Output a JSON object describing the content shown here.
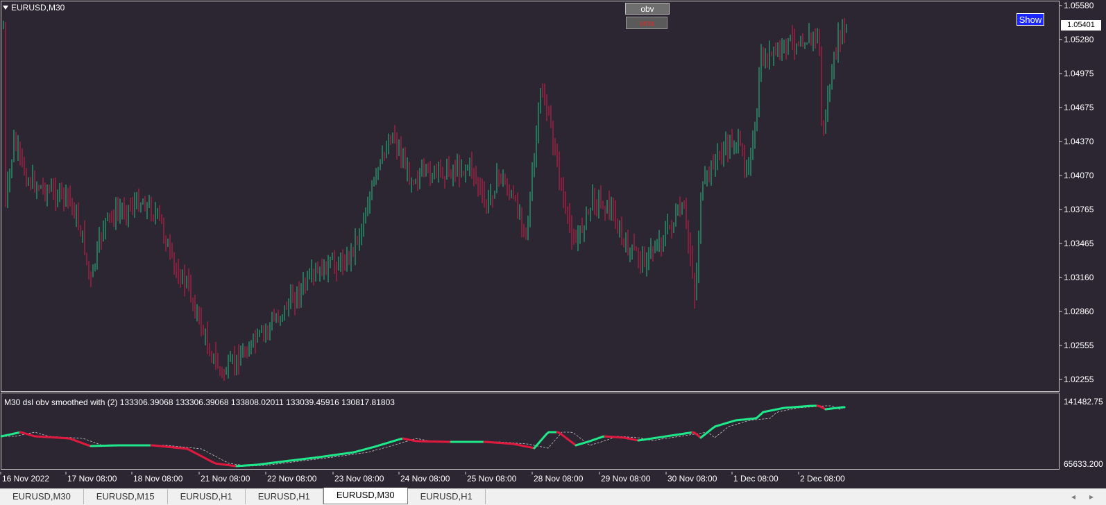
{
  "chart": {
    "symbol_label": "EURUSD,M30",
    "buttons": {
      "obv": "obv",
      "uma": "uma",
      "show": "Show"
    },
    "current_price": "1.05401",
    "price_axis": [
      "1.05580",
      "1.05280",
      "1.04975",
      "1.04675",
      "1.04370",
      "1.04070",
      "1.03765",
      "1.03465",
      "1.03160",
      "1.02860",
      "1.02555",
      "1.02255"
    ],
    "indicator_label": "M30 dsl obv smoothed with  (2) 133306.39068 133306.39068 133808.02011 133039.45916 130817.81803",
    "indicator_axis": [
      "141482.75",
      "65633.200"
    ],
    "time_axis": [
      "16 Nov 2022",
      "17 Nov 08:00",
      "18 Nov 08:00",
      "21 Nov 08:00",
      "22 Nov 08:00",
      "23 Nov 08:00",
      "24 Nov 08:00",
      "25 Nov 08:00",
      "28 Nov 08:00",
      "29 Nov 08:00",
      "30 Nov 08:00",
      "1 Dec 08:00",
      "2 Dec 08:00"
    ],
    "colors": {
      "bull": "#26c281",
      "bear": "#d41e4a",
      "obv_up": "#1ee88a",
      "obv_down": "#e0193f",
      "background": "#2b2632"
    }
  },
  "tabs": [
    {
      "label": "EURUSD,M30",
      "active": false
    },
    {
      "label": "EURUSD,M15",
      "active": false
    },
    {
      "label": "EURUSD,H1",
      "active": false
    },
    {
      "label": "EURUSD,H1",
      "active": false
    },
    {
      "label": "EURUSD,M30",
      "active": true
    },
    {
      "label": "EURUSD,H1",
      "active": false
    }
  ],
  "scroll": {
    "left": "◂",
    "right": "▸"
  }
}
